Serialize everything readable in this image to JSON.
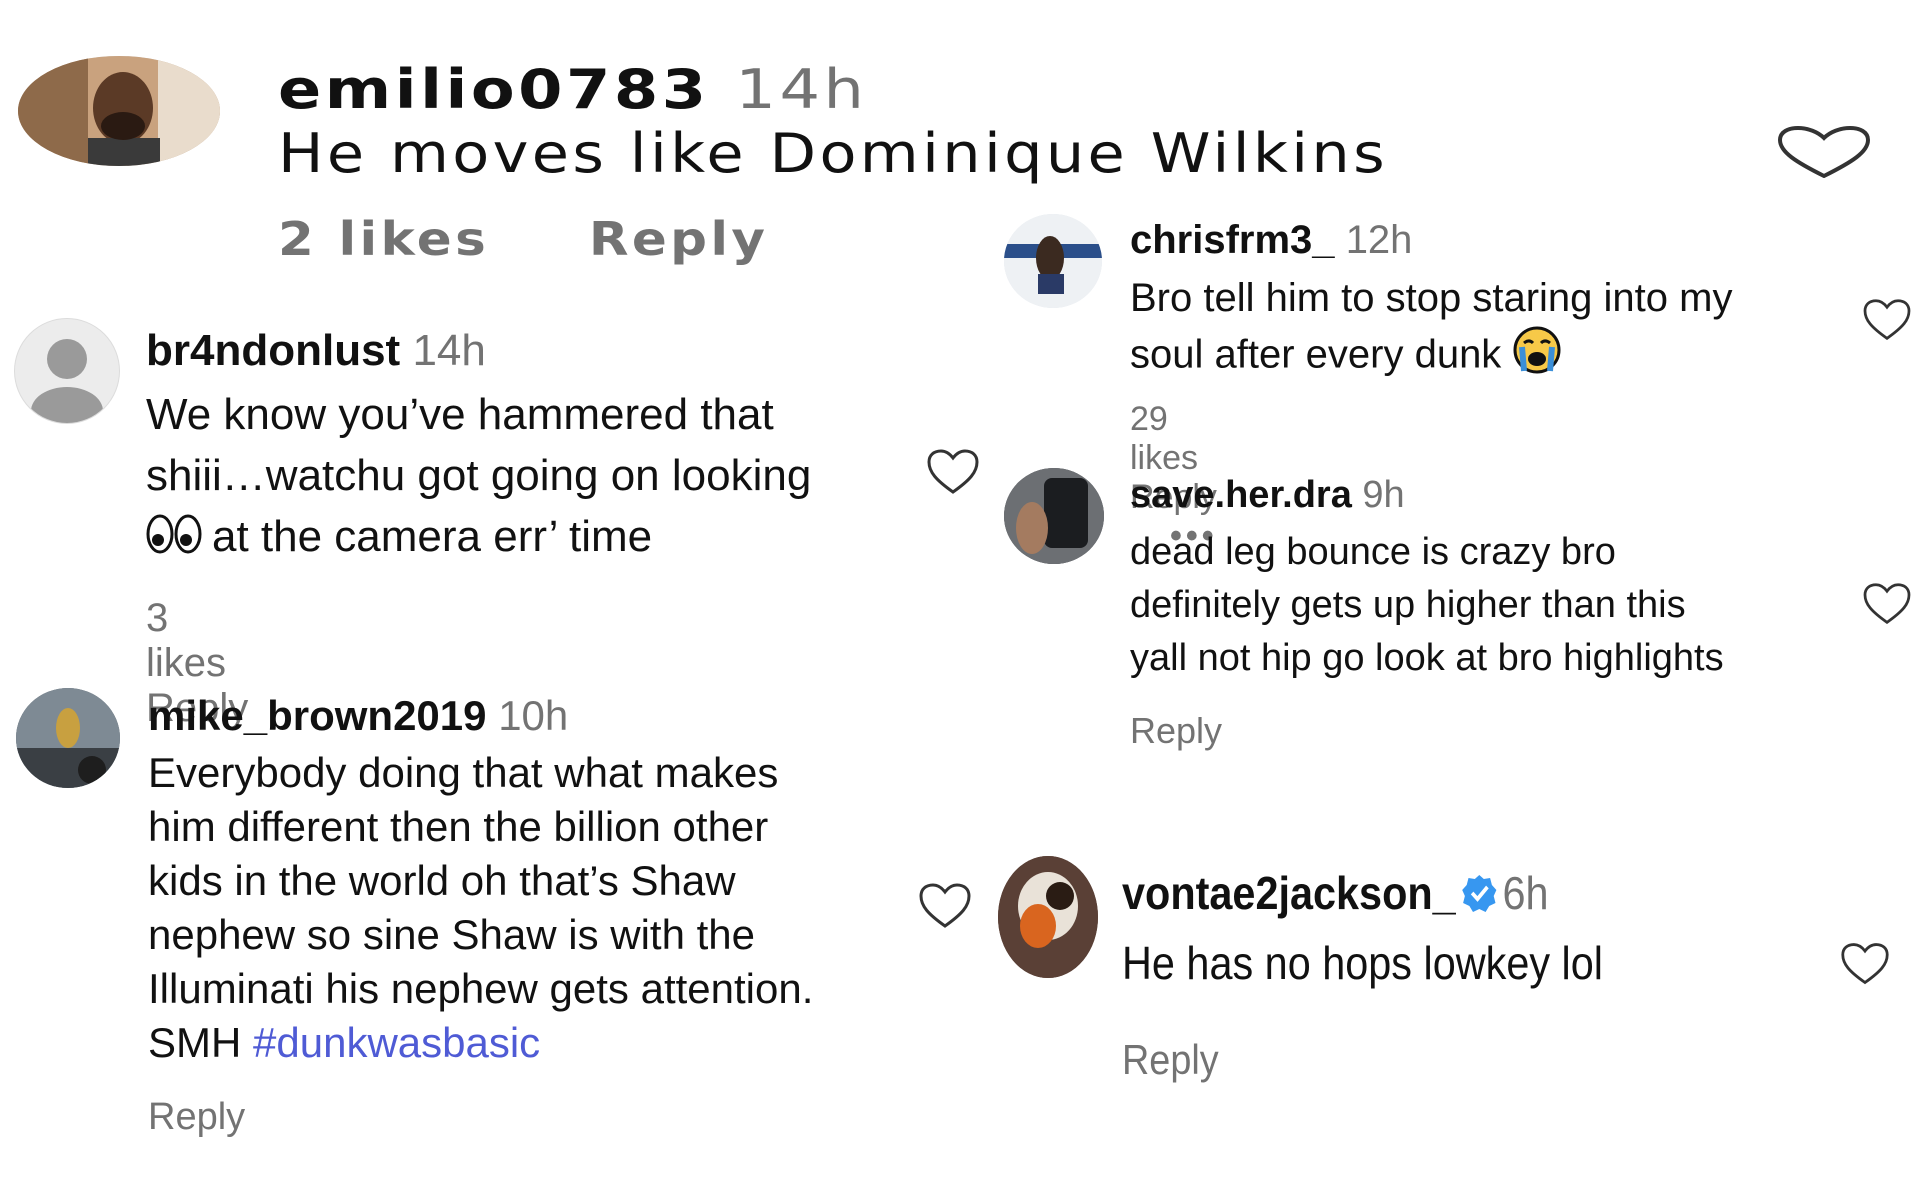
{
  "comments": [
    {
      "username": "emilio0783",
      "time": "14h",
      "text": "He moves like Dominique Wilkins",
      "likes": "2 likes",
      "reply": "Reply"
    },
    {
      "username": "br4ndonlust",
      "time": "14h",
      "text_line1": "We know you’ve hammered that",
      "text_line2": "shiii…watchu got going on looking",
      "text_line3": "at the camera err’ time",
      "likes": "3 likes",
      "reply": "Reply"
    },
    {
      "username": "mike_brown2019",
      "time": "10h",
      "text_line1": "Everybody doing that what makes",
      "text_line2": "him different then the billion other",
      "text_line3": "kids in the world oh that’s Shaw",
      "text_line4": "nephew so sine Shaw is with the",
      "text_line5": "Illuminati his nephew gets attention.",
      "text_line6_prefix": "SMH",
      "hashtag": "#dunkwasbasic",
      "reply": "Reply"
    },
    {
      "username": "chrisfrm3_",
      "time": "12h",
      "text_line1": "Bro tell him to stop staring into my",
      "text_line2": "soul after every dunk",
      "likes": "29 likes",
      "reply": "Reply",
      "more": "•••"
    },
    {
      "username": "save.her.dra",
      "time": "9h",
      "text_line1": "dead leg bounce is crazy bro",
      "text_line2": "definitely gets up higher than this",
      "text_line3": "yall not hip go look at bro highlights",
      "reply": "Reply"
    },
    {
      "username": "vontae2jackson_",
      "time": "6h",
      "text": "He has no hops lowkey lol",
      "reply": "Reply"
    }
  ],
  "colors": {
    "text": "#111111",
    "muted": "#737373",
    "hashtag": "#4f5bd5",
    "verified": "#3797f0"
  },
  "icons": [
    "heart-icon",
    "verified-badge-icon",
    "eyes-emoji-icon",
    "crying-emoji-icon"
  ]
}
